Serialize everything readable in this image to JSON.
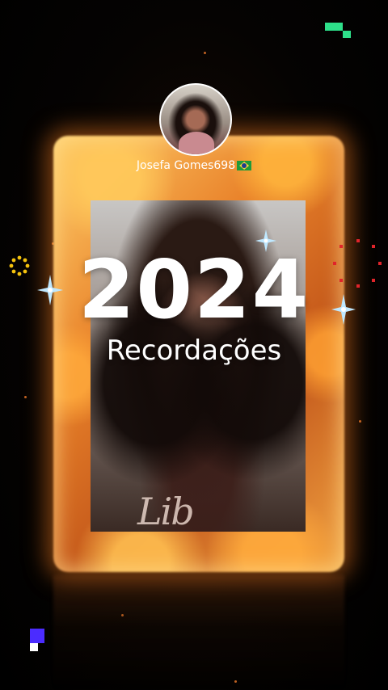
{
  "profile": {
    "username": "Josefa Gomes698",
    "flag": "brazil-flag-icon"
  },
  "title": {
    "year": "2024",
    "subtitle": "Recordações"
  },
  "photo": {
    "overlay_text": "Lib"
  },
  "colors": {
    "fire": "#e9822a",
    "accent_green": "#2ee08a",
    "accent_blue": "#4b2cff",
    "red_dots": "#e0242a",
    "gold_dots": "#f4c20d",
    "sparkle": "#bfe8ff"
  }
}
